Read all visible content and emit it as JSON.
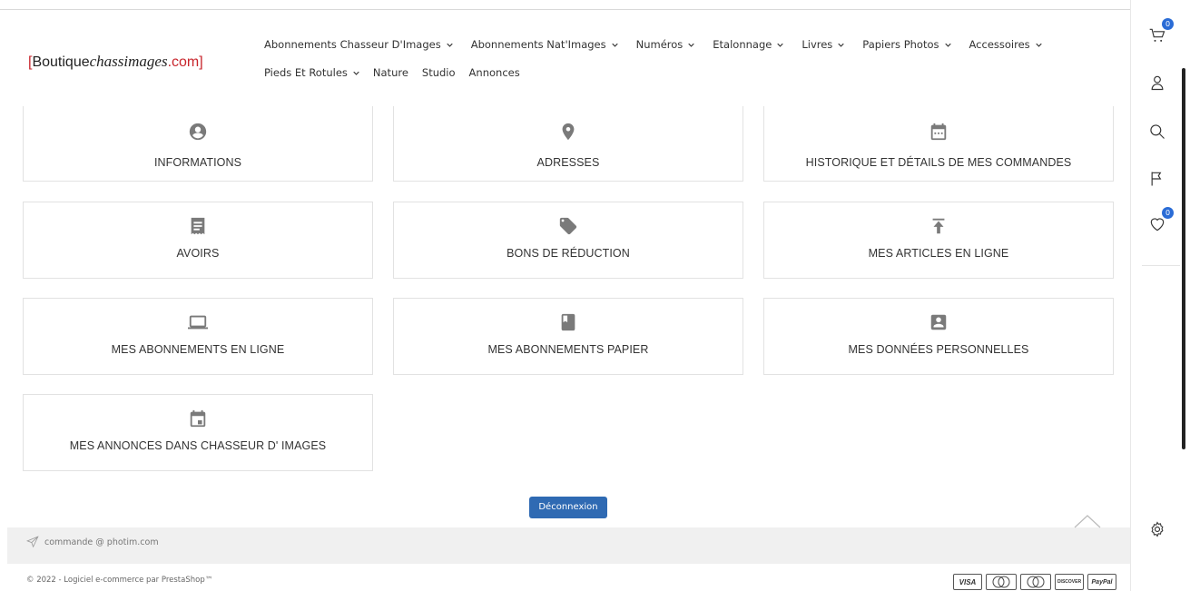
{
  "header": {
    "logo": {
      "open_bracket": "[",
      "part1": "Boutique",
      "part2": "chassimages",
      "part3": ".com]"
    },
    "nav_row1": [
      {
        "label": "Abonnements Chasseur D'Images",
        "dropdown": true
      },
      {
        "label": "Abonnements Nat'Images",
        "dropdown": true
      },
      {
        "label": "Numéros",
        "dropdown": true
      },
      {
        "label": "Etalonnage",
        "dropdown": true
      },
      {
        "label": "Livres",
        "dropdown": true
      },
      {
        "label": "Papiers Photos",
        "dropdown": true
      },
      {
        "label": "Accessoires",
        "dropdown": true
      }
    ],
    "nav_row2": [
      {
        "label": "Pieds Et Rotules",
        "dropdown": true
      },
      {
        "label": "Nature",
        "dropdown": false
      },
      {
        "label": "Studio",
        "dropdown": false
      },
      {
        "label": "Annonces",
        "dropdown": false
      }
    ]
  },
  "rail": {
    "cart_count": "0",
    "wishlist_count": "0",
    "icons": [
      "cart-icon",
      "user-icon",
      "search-icon",
      "flag-icon",
      "heart-icon",
      "gear-icon"
    ]
  },
  "account": {
    "cards": [
      {
        "label": "INFORMATIONS",
        "icon": "account-circle-icon"
      },
      {
        "label": "ADRESSES",
        "icon": "location-pin-icon"
      },
      {
        "label": "HISTORIQUE ET DÉTAILS DE MES COMMANDES",
        "icon": "calendar-icon"
      },
      {
        "label": "AVOIRS",
        "icon": "receipt-icon"
      },
      {
        "label": "BONS DE RÉDUCTION",
        "icon": "tag-icon"
      },
      {
        "label": "MES ARTICLES EN LIGNE",
        "icon": "upload-icon"
      },
      {
        "label": "MES ABONNEMENTS EN LIGNE",
        "icon": "laptop-icon"
      },
      {
        "label": "MES ABONNEMENTS PAPIER",
        "icon": "book-icon"
      },
      {
        "label": "MES DONNÉES PERSONNELLES",
        "icon": "contact-card-icon"
      },
      {
        "label": "MES ANNONCES DANS CHASSEUR D' IMAGES",
        "icon": "event-icon"
      }
    ],
    "logout_label": "Déconnexion"
  },
  "footer": {
    "email": "commande @ photim.com",
    "copyright": "© 2022 - Logiciel e-commerce par PrestaShop™",
    "payments": [
      "VISA",
      "mastercard",
      "maestro",
      "DISCOVER",
      "PayPal"
    ]
  },
  "colors": {
    "brand_red": "#c8252c",
    "accent_blue": "#2f6ab3",
    "badge_blue": "#2a6cd6"
  }
}
